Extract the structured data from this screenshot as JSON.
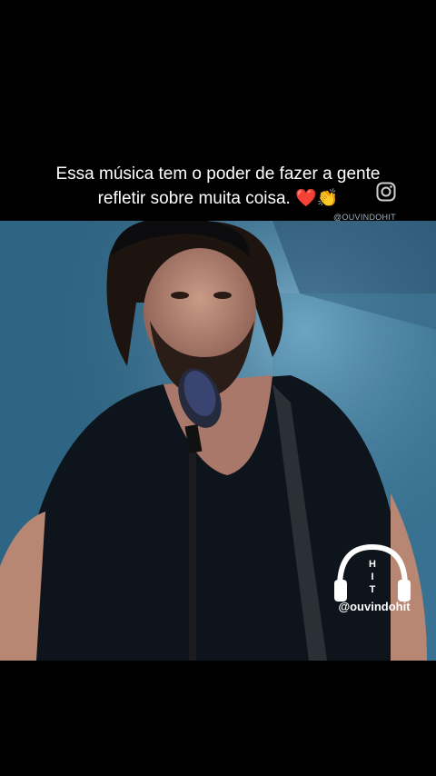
{
  "caption": {
    "line1": "Essa música tem o poder de fazer a gente",
    "line2": "refletir sobre muita coisa. ❤️👏"
  },
  "icons": {
    "instagram": "instagram-icon",
    "headphones": "headphones-logo-icon"
  },
  "watermark_top": "@OUVINDOHIT",
  "logo": {
    "letters": [
      "H",
      "I",
      "T"
    ],
    "handle": "@ouvindohit"
  },
  "colors": {
    "background": "#000000",
    "text": "#ffffff",
    "stage_blue": "#3d7a99"
  }
}
